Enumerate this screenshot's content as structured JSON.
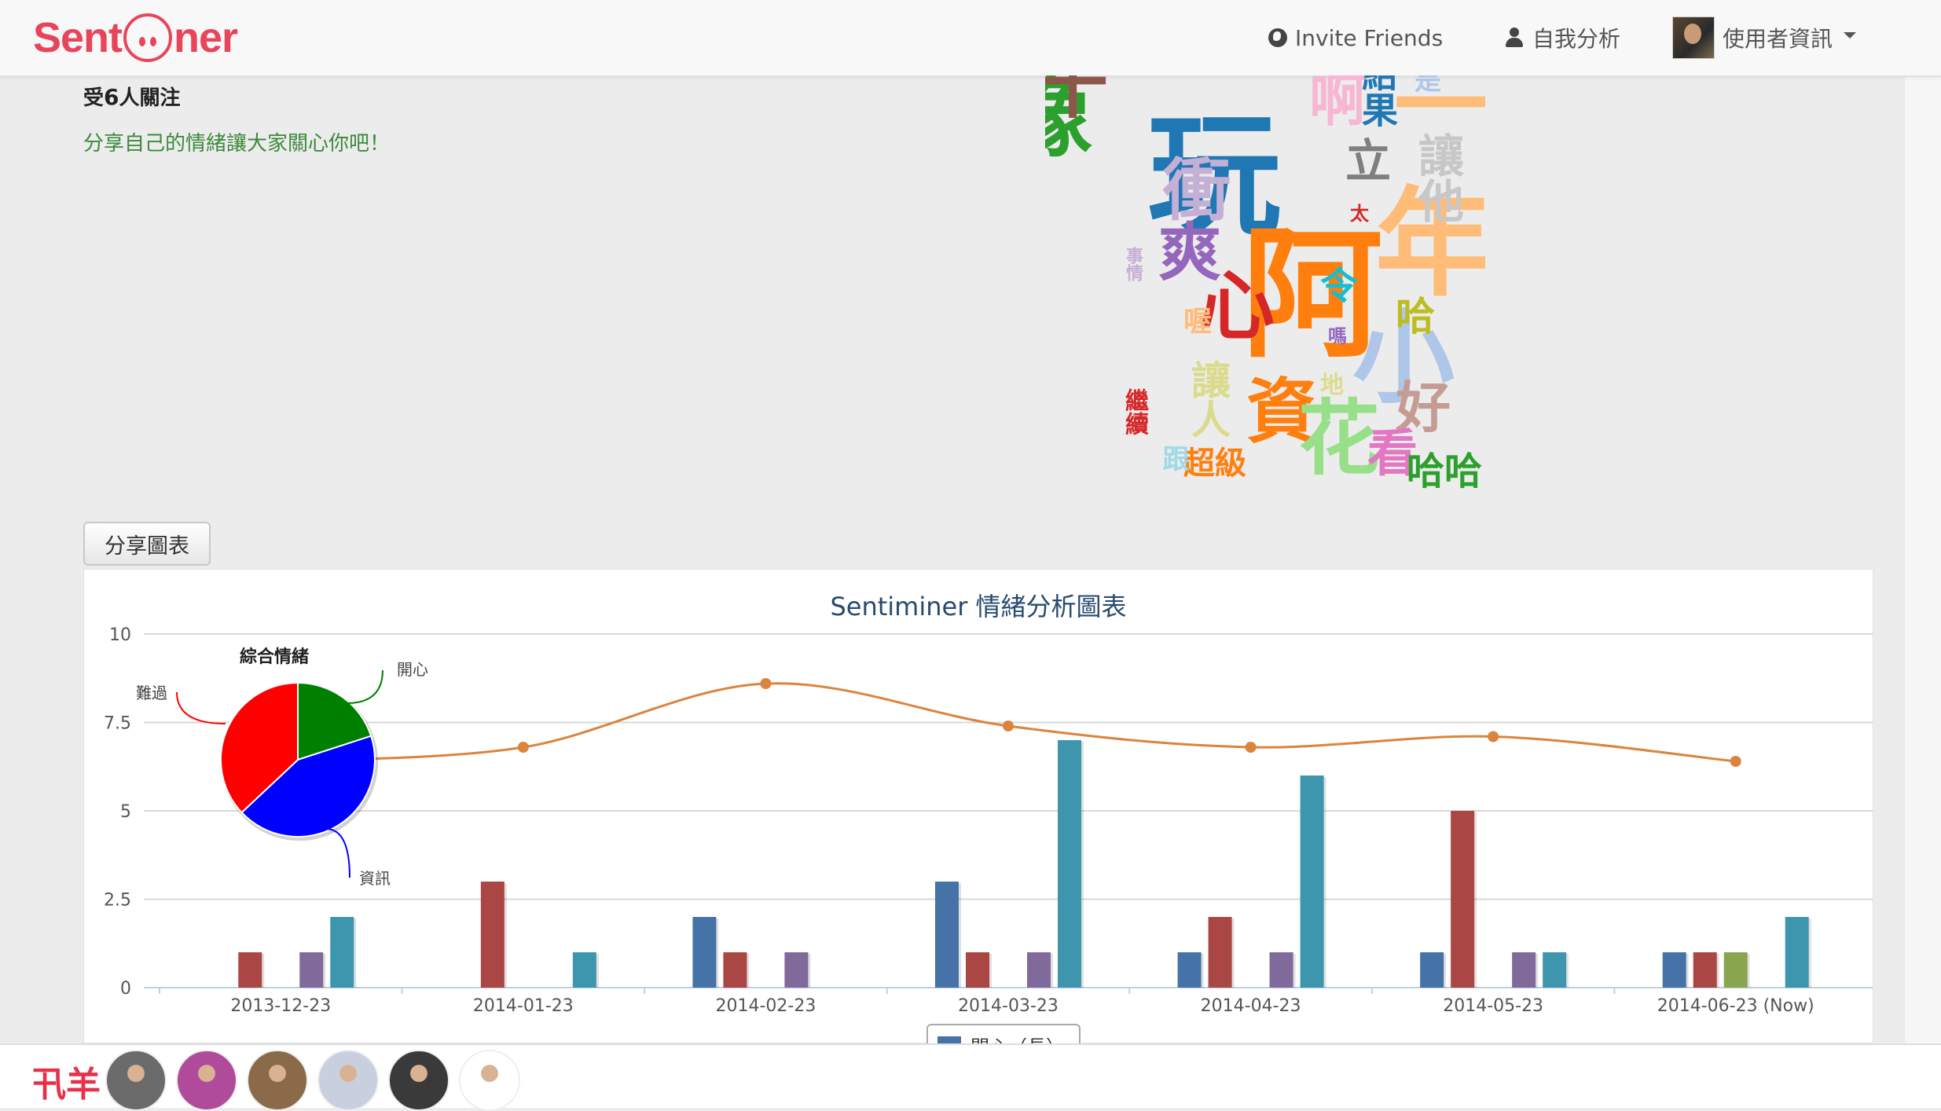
{
  "app": {
    "logo_text_left": "Sent",
    "logo_text_right": "ner",
    "brand_color": "#e8455a"
  },
  "navbar": {
    "invite_label": "Invite Friends",
    "invite_icon": "globe-icon",
    "self_analysis_label": "自我分析",
    "self_analysis_icon": "user-icon",
    "user_info_label": "使用者資訊"
  },
  "profile": {
    "followers_prefix": "受",
    "followers_count": "6",
    "followers_suffix": "人關注",
    "slogan": "分享自己的情緒讓大家關心你吧！"
  },
  "wordcloud": [
    {
      "text": "像",
      "color": "#2ca02c"
    },
    {
      "text": "玩",
      "color": "#1f77b4"
    },
    {
      "text": "阿",
      "color": "#ff7f0e"
    },
    {
      "text": "年",
      "color": "#ffbb78"
    },
    {
      "text": "小",
      "color": "#aec7e8"
    },
    {
      "text": "一",
      "color": "#ffbb78"
    },
    {
      "text": "心",
      "color": "#d62728"
    },
    {
      "text": "衝",
      "color": "#c5b0d5"
    },
    {
      "text": "爽",
      "color": "#9467bd"
    },
    {
      "text": "資",
      "color": "#ff7f0e"
    },
    {
      "text": "花",
      "color": "#98df8a"
    },
    {
      "text": "好",
      "color": "#c49c94"
    },
    {
      "text": "看",
      "color": "#e377c2"
    },
    {
      "text": "哈哈",
      "color": "#2ca02c"
    },
    {
      "text": "超級",
      "color": "#ff7f0e"
    },
    {
      "text": "讓人",
      "color": "#dbdb8d"
    },
    {
      "text": "讓他",
      "color": "#c7c7c7"
    },
    {
      "text": "立",
      "color": "#7f7f7f"
    },
    {
      "text": "結果",
      "color": "#1f77b4"
    },
    {
      "text": "啊",
      "color": "#f7b6d2"
    },
    {
      "text": "令",
      "color": "#17becf"
    },
    {
      "text": "哈",
      "color": "#bcbd22"
    },
    {
      "text": "喔",
      "color": "#ffbb78"
    },
    {
      "text": "跟",
      "color": "#9edae5"
    },
    {
      "text": "地",
      "color": "#dbdb8d"
    },
    {
      "text": "嗎",
      "color": "#9467bd"
    },
    {
      "text": "太",
      "color": "#d62728"
    },
    {
      "text": "事情",
      "color": "#c5b0d5"
    },
    {
      "text": "繼續",
      "color": "#d62728"
    },
    {
      "text": "十",
      "color": "#8c564b"
    },
    {
      "text": "是",
      "color": "#aec7e8"
    }
  ],
  "share_button_label": "分享圖表",
  "legend_first_label": "開心（長）",
  "chart_data": {
    "type": "bar",
    "title": "Sentiminer 情緒分析圖表",
    "categories": [
      "2013-12-23",
      "2014-01-23",
      "2014-02-23",
      "2014-03-23",
      "2014-04-23",
      "2014-05-23",
      "2014-06-23 (Now)"
    ],
    "ylim": [
      0,
      10
    ],
    "yticks": [
      "0",
      "2.5",
      "5",
      "7.5",
      "10"
    ],
    "series": [
      {
        "color": "#4572a7",
        "values": [
          0,
          0,
          2,
          3,
          1,
          1,
          1
        ]
      },
      {
        "color": "#aa4643",
        "values": [
          1,
          3,
          1,
          1,
          2,
          5,
          1
        ]
      },
      {
        "color": "#89a54e",
        "values": [
          0,
          0,
          0,
          0,
          0,
          0,
          1
        ]
      },
      {
        "color": "#80699b",
        "values": [
          1,
          0,
          1,
          1,
          1,
          1,
          0
        ]
      },
      {
        "color": "#3d96ae",
        "values": [
          2,
          1,
          0,
          7,
          6,
          1,
          2
        ]
      }
    ],
    "line": {
      "type": "spline",
      "color": "#db843d",
      "values": [
        6.4,
        6.8,
        8.6,
        7.4,
        6.8,
        7.1,
        6.4
      ]
    },
    "pie": {
      "title": "綜合情緒",
      "slices": [
        {
          "name": "開心",
          "value": 0.2,
          "color": "#008000"
        },
        {
          "name": "資訊",
          "value": 0.43,
          "color": "#0000ff"
        },
        {
          "name": "難過",
          "value": 0.37,
          "color": "#ff0000"
        }
      ]
    }
  },
  "friends": {
    "label": "卂羊",
    "avatars": [
      {
        "name": "friend-avatar-1",
        "color": "#6b6b6b"
      },
      {
        "name": "friend-avatar-2",
        "color": "#b04a9a"
      },
      {
        "name": "friend-avatar-3",
        "color": "#8a6a48"
      },
      {
        "name": "friend-avatar-4",
        "color": "#c8d0e0"
      },
      {
        "name": "friend-avatar-5",
        "color": "#3a3a3a"
      },
      {
        "name": "friend-avatar-6",
        "color": "#ffffff"
      }
    ]
  }
}
